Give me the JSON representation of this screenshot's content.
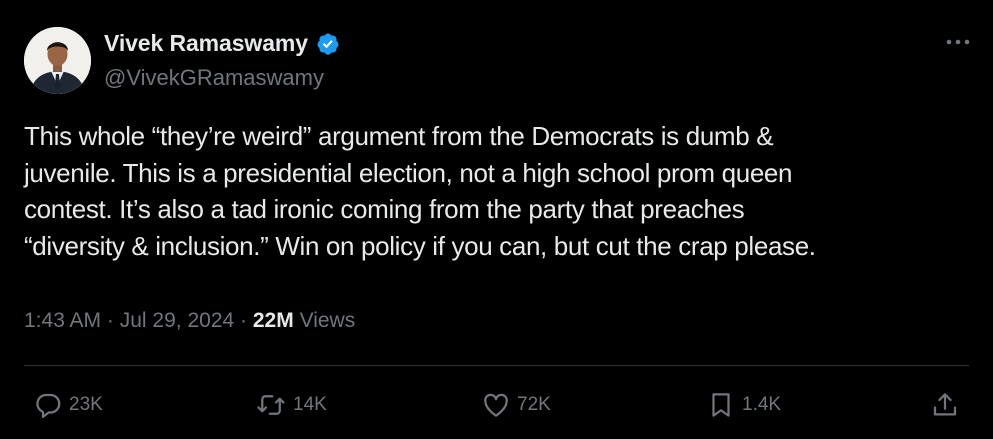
{
  "author": {
    "display_name": "Vivek Ramaswamy",
    "handle": "@VivekGRamaswamy",
    "verified": true,
    "verified_color": "#1d9bf0",
    "avatar_icon": "profile-photo"
  },
  "tweet": {
    "text_lines": [
      "This whole “they’re weird” argument from the Democrats is dumb &",
      "juvenile. This is a presidential election, not a high school prom queen",
      "contest. It’s also a tad ironic coming from the party that preaches",
      "“diversity & inclusion.” Win on policy if you can, but cut the crap please."
    ]
  },
  "meta": {
    "time": "1:43 AM",
    "separator": "·",
    "date": "Jul 29, 2024",
    "views_count": "22M",
    "views_label": "Views"
  },
  "actions": {
    "reply": {
      "icon": "reply-icon",
      "count": "23K"
    },
    "retweet": {
      "icon": "retweet-icon",
      "count": "14K"
    },
    "like": {
      "icon": "heart-icon",
      "count": "72K"
    },
    "bookmark": {
      "icon": "bookmark-icon",
      "count": "1.4K"
    },
    "share": {
      "icon": "share-icon"
    }
  },
  "colors": {
    "background": "#000000",
    "text_primary": "#e7e9ea",
    "text_secondary": "#71767b",
    "divider": "#2f3336"
  }
}
